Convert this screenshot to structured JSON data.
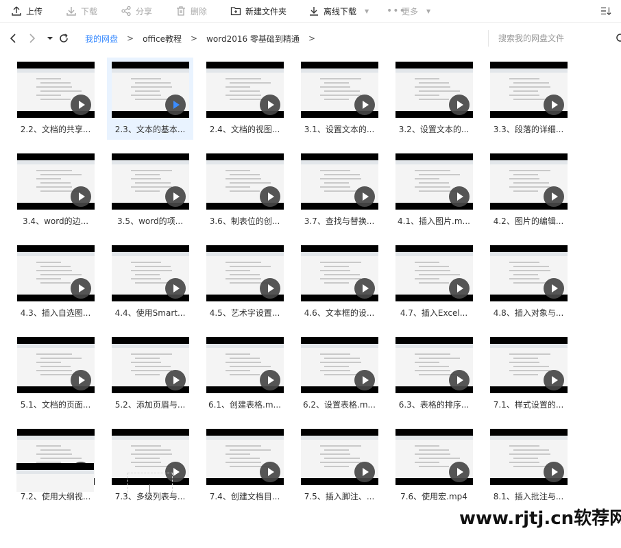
{
  "toolbar": {
    "upload": "上传",
    "download": "下载",
    "share": "分享",
    "delete": "删除",
    "new_folder": "新建文件夹",
    "offline_download": "离线下载",
    "more": "更多"
  },
  "nav": {
    "breadcrumbs": [
      "我的网盘",
      "office教程",
      "word2016 零基础到精通"
    ],
    "separator": ">",
    "search_placeholder": "搜索我的网盘文件"
  },
  "files": [
    {
      "name": "2.2、文档的共享..."
    },
    {
      "name": "2.3、文本的基本...",
      "selected": true
    },
    {
      "name": "2.4、文档的视图..."
    },
    {
      "name": "3.1、设置文本的..."
    },
    {
      "name": "3.2、设置文本的..."
    },
    {
      "name": "3.3、段落的详细..."
    },
    {
      "name": "3.4、word的边..."
    },
    {
      "name": "3.5、word的项..."
    },
    {
      "name": "3.6、制表位的创..."
    },
    {
      "name": "3.7、查找与替换..."
    },
    {
      "name": "4.1、插入图片.m..."
    },
    {
      "name": "4.2、图片的编辑..."
    },
    {
      "name": "4.3、插入自选图..."
    },
    {
      "name": "4.4、使用Smart..."
    },
    {
      "name": "4.5、艺术字设置..."
    },
    {
      "name": "4.6、文本框的设..."
    },
    {
      "name": "4.7、插入Excel..."
    },
    {
      "name": "4.8、插入对象与..."
    },
    {
      "name": "5.1、文档的页面..."
    },
    {
      "name": "5.2、添加页眉与..."
    },
    {
      "name": "6.1、创建表格.m..."
    },
    {
      "name": "6.2、设置表格.m..."
    },
    {
      "name": "6.3、表格的排序..."
    },
    {
      "name": "7.1、样式设置的..."
    },
    {
      "name": "7.2、使用大纲视..."
    },
    {
      "name": "7.3、多级列表与..."
    },
    {
      "name": "7.4、创建文档目..."
    },
    {
      "name": "7.5、插入脚注、..."
    },
    {
      "name": "7.6、使用宏.mp4"
    },
    {
      "name": "8.1、插入批注与..."
    }
  ],
  "watermark": "www.rjtj.cn软荐网",
  "colors": {
    "link": "#3b8cff",
    "selected_bg": "#e9f3ff",
    "play_accent": "#3b8cff"
  }
}
